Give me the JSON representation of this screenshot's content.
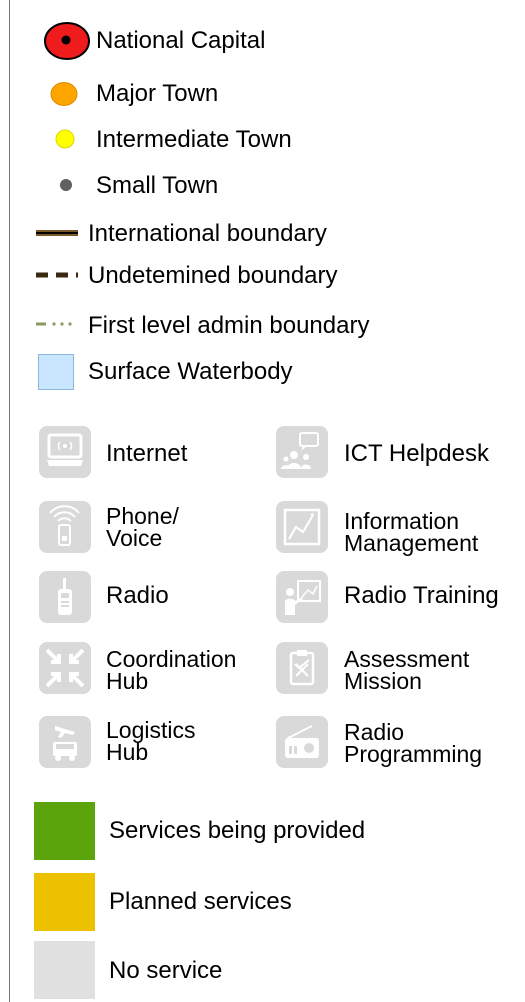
{
  "legend": {
    "place_symbols": [
      {
        "label": "National Capital",
        "icon": "national-capital-icon"
      },
      {
        "label": "Major Town",
        "icon": "major-town-icon"
      },
      {
        "label": "Intermediate Town",
        "icon": "intermediate-town-icon"
      },
      {
        "label": "Small Town",
        "icon": "small-town-icon"
      }
    ],
    "boundaries": [
      {
        "label": "International boundary",
        "icon": "international-boundary-icon"
      },
      {
        "label": "Undetemined boundary",
        "icon": "undetermined-boundary-icon"
      },
      {
        "label": "First level admin boundary",
        "icon": "admin-boundary-icon"
      }
    ],
    "water": {
      "label": "Surface Waterbody",
      "icon": "waterbody-icon"
    },
    "services_icons": [
      {
        "line1": "Internet",
        "line2": "",
        "icon": "internet-icon"
      },
      {
        "line1": "ICT Helpdesk",
        "line2": "",
        "icon": "ict-helpdesk-icon"
      },
      {
        "line1": "Phone/",
        "line2": "Voice",
        "icon": "phone-icon"
      },
      {
        "line1": "Information",
        "line2": "Management",
        "icon": "information-management-icon"
      },
      {
        "line1": "Radio",
        "line2": "",
        "icon": "radio-icon"
      },
      {
        "line1": "Radio Training",
        "line2": "",
        "icon": "radio-training-icon"
      },
      {
        "line1": "Coordination",
        "line2": "Hub",
        "icon": "coordination-hub-icon"
      },
      {
        "line1": "Assessment",
        "line2": "Mission",
        "icon": "assessment-mission-icon"
      },
      {
        "line1": "Logistics",
        "line2": "Hub",
        "icon": "logistics-hub-icon"
      },
      {
        "line1": "Radio",
        "line2": "Programming",
        "icon": "radio-programming-icon"
      }
    ],
    "service_status": [
      {
        "label": "Services being provided",
        "color": "#5ba40c"
      },
      {
        "label": "Planned services",
        "color": "#ecc100"
      },
      {
        "label": "No service",
        "color": "#e0e0e0"
      }
    ],
    "colors": {
      "capital_fill": "#ee1c1c",
      "major_town": "#ffa500",
      "intermediate_town": "#ffff00",
      "small_town": "#606060",
      "waterbody": "#cbe6ff",
      "icon_tile": "#d9d9d9"
    }
  }
}
